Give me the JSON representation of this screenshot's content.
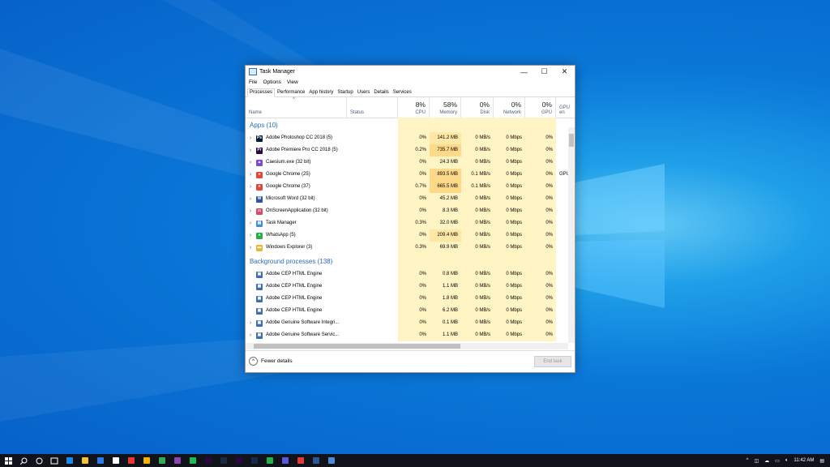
{
  "window": {
    "title": "Task Manager",
    "controls": {
      "minimize": "—",
      "maximize": "☐",
      "close": "✕"
    }
  },
  "menu": [
    "File",
    "Options",
    "View"
  ],
  "tabs": [
    "Processes",
    "Performance",
    "App history",
    "Startup",
    "Users",
    "Details",
    "Services"
  ],
  "header": {
    "name": "Name",
    "status": "Status",
    "cpu": {
      "pct": "8%",
      "label": "CPU"
    },
    "memory": {
      "pct": "58%",
      "label": "Memory"
    },
    "disk": {
      "pct": "0%",
      "label": "Disk"
    },
    "network": {
      "pct": "0%",
      "label": "Network"
    },
    "gpu": {
      "pct": "0%",
      "label": "GPU"
    },
    "gpu_engine": "GPU en"
  },
  "apps_section": "Apps (10)",
  "apps": [
    {
      "name": "Adobe Photoshop CC 2018 (5)",
      "cpu": "0%",
      "mem": "141.2 MB",
      "disk": "0 MB/s",
      "net": "0 Mbps",
      "gpu": "0%",
      "gpuen": "",
      "icon": "#001e36",
      "glyph": "Ps"
    },
    {
      "name": "Adobe Premiere Pro CC 2018 (5)",
      "cpu": "0.2%",
      "mem": "735.7 MB",
      "disk": "0 MB/s",
      "net": "0 Mbps",
      "gpu": "0%",
      "gpuen": "",
      "icon": "#2a0a3e",
      "glyph": "Pr"
    },
    {
      "name": "Caesium.exe (32 bit)",
      "cpu": "0%",
      "mem": "24.3 MB",
      "disk": "0 MB/s",
      "net": "0 Mbps",
      "gpu": "0%",
      "gpuen": "",
      "icon": "#7a4bd6",
      "glyph": "▲"
    },
    {
      "name": "Google Chrome (25)",
      "cpu": "0%",
      "mem": "893.5 MB",
      "disk": "0.1 MB/s",
      "net": "0 Mbps",
      "gpu": "0%",
      "gpuen": "GPU",
      "icon": "#e8453c",
      "glyph": "●"
    },
    {
      "name": "Google Chrome (37)",
      "cpu": "0.7%",
      "mem": "665.5 MB",
      "disk": "0.1 MB/s",
      "net": "0 Mbps",
      "gpu": "0%",
      "gpuen": "",
      "icon": "#e8453c",
      "glyph": "●"
    },
    {
      "name": "Microsoft Word (32 bit)",
      "cpu": "0%",
      "mem": "45.2 MB",
      "disk": "0 MB/s",
      "net": "0 Mbps",
      "gpu": "0%",
      "gpuen": "",
      "icon": "#2b5797",
      "glyph": "W"
    },
    {
      "name": "OnScreenApplication (32 bit)",
      "cpu": "0%",
      "mem": "8.3 MB",
      "disk": "0 MB/s",
      "net": "0 Mbps",
      "gpu": "0%",
      "gpuen": "",
      "icon": "#d24b6b",
      "glyph": "▭"
    },
    {
      "name": "Task Manager",
      "cpu": "0.3%",
      "mem": "32.0 MB",
      "disk": "0 MB/s",
      "net": "0 Mbps",
      "gpu": "0%",
      "gpuen": "",
      "icon": "#4a8bd6",
      "glyph": "▤"
    },
    {
      "name": "WhatsApp (5)",
      "cpu": "0%",
      "mem": "209.4 MB",
      "disk": "0 MB/s",
      "net": "0 Mbps",
      "gpu": "0%",
      "gpuen": "",
      "icon": "#25b14a",
      "glyph": "●"
    },
    {
      "name": "Windows Explorer (3)",
      "cpu": "0.3%",
      "mem": "69.9 MB",
      "disk": "0 MB/s",
      "net": "0 Mbps",
      "gpu": "0%",
      "gpuen": "",
      "icon": "#e9b73a",
      "glyph": "▬"
    }
  ],
  "bg_section": "Background processes (138)",
  "background": [
    {
      "name": "Adobe CEP HTML Engine",
      "cpu": "0%",
      "mem": "0.8 MB",
      "disk": "0 MB/s",
      "net": "0 Mbps",
      "gpu": "0%",
      "expand": false
    },
    {
      "name": "Adobe CEP HTML Engine",
      "cpu": "0%",
      "mem": "1.1 MB",
      "disk": "0 MB/s",
      "net": "0 Mbps",
      "gpu": "0%",
      "expand": false
    },
    {
      "name": "Adobe CEP HTML Engine",
      "cpu": "0%",
      "mem": "1.8 MB",
      "disk": "0 MB/s",
      "net": "0 Mbps",
      "gpu": "0%",
      "expand": false
    },
    {
      "name": "Adobe CEP HTML Engine",
      "cpu": "0%",
      "mem": "6.2 MB",
      "disk": "0 MB/s",
      "net": "0 Mbps",
      "gpu": "0%",
      "expand": false
    },
    {
      "name": "Adobe Genuine Software Integri...",
      "cpu": "0%",
      "mem": "0.1 MB",
      "disk": "0 MB/s",
      "net": "0 Mbps",
      "gpu": "0%",
      "expand": true
    },
    {
      "name": "Adobe Genuine Software Servic...",
      "cpu": "0%",
      "mem": "1.1 MB",
      "disk": "0 MB/s",
      "net": "0 Mbps",
      "gpu": "0%",
      "expand": true
    }
  ],
  "footer": {
    "fewer_details": "Fewer details",
    "end_task": "End task"
  },
  "taskbar": {
    "time": "11:42 AM",
    "pinned": [
      "#1e88e5",
      "#f2c230",
      "#2a7de1",
      "#ffffff",
      "#e53935",
      "#f4b400",
      "#34a853",
      "#8e44ad",
      "#1db954",
      "#2a0a3e",
      "#1f2a44",
      "#2a0a3e",
      "#122b4a",
      "#25b14a",
      "#5b5bd6",
      "#e53935",
      "#2b5797",
      "#4a8bd6"
    ]
  }
}
